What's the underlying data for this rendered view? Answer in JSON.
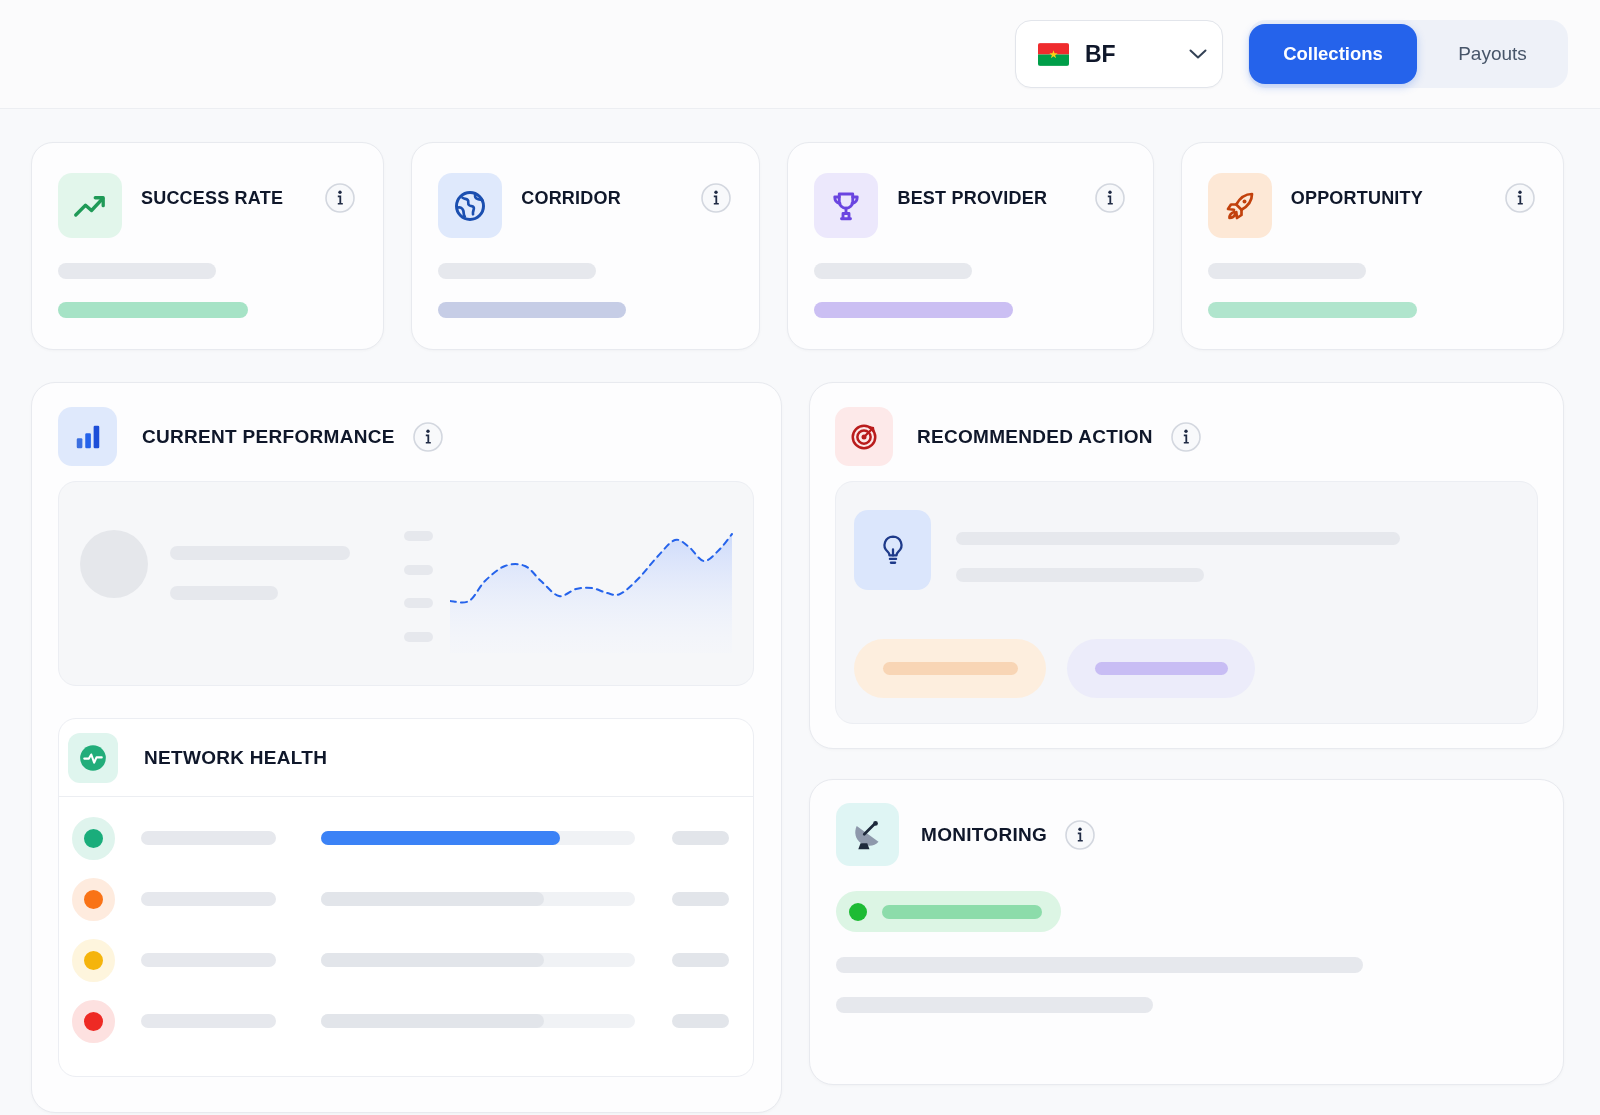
{
  "header": {
    "country_select": {
      "value": "BF"
    },
    "tabs": [
      {
        "label": "Collections",
        "selected": true
      },
      {
        "label": "Payouts",
        "selected": false
      }
    ]
  },
  "kpi_cards": [
    {
      "title": "SUCCESS RATE",
      "info": true,
      "color": "#a6e3c6"
    },
    {
      "title": "CORRIDOR",
      "info": true,
      "color": "#c6cde6"
    },
    {
      "title": "BEST PROVIDER",
      "info": true,
      "color": "#cbbff3"
    },
    {
      "title": "OPPORTUNITY",
      "info": true,
      "color": "#b0e5cd"
    }
  ],
  "current_performance": {
    "title": "CURRENT PERFORMANCE",
    "info": true
  },
  "network_health": {
    "title": "NETWORK HEALTH",
    "rows": [
      {
        "color": "#1aad7b",
        "level": 0.76,
        "highlighted": true
      },
      {
        "color": "#f97316",
        "level": 0.71,
        "highlighted": false
      },
      {
        "color": "#f5b40c",
        "level": 0.71,
        "highlighted": false
      },
      {
        "color": "#ee2a24",
        "level": 0.71,
        "highlighted": false
      }
    ]
  },
  "recommended_action": {
    "title": "RECOMMENDED ACTION",
    "info": true
  },
  "monitoring": {
    "title": "MONITORING",
    "info": true,
    "online": true
  }
}
